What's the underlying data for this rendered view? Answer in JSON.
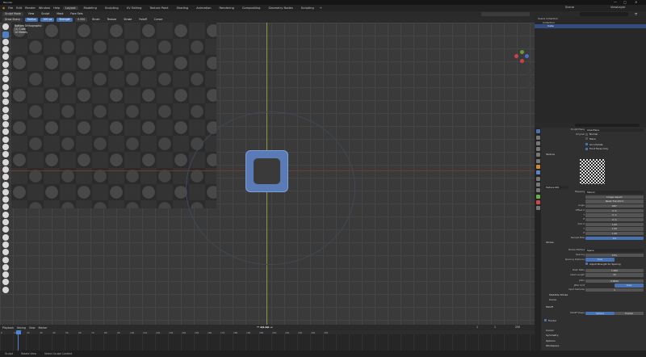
{
  "window": {
    "title": "Blender"
  },
  "menubar": {
    "items": [
      "File",
      "Edit",
      "Render",
      "Window",
      "Help"
    ],
    "workspaces": [
      "Layout",
      "Modeling",
      "Sculpting",
      "UV Editing",
      "Texture Paint",
      "Shading",
      "Animation",
      "Rendering",
      "Compositing",
      "Geometry Nodes",
      "Scripting"
    ],
    "active_workspace": "Layout",
    "scene": "Scene",
    "view_layer": "ViewLayer"
  },
  "viewport": {
    "header1": {
      "mode": "Sculpt Mode",
      "menus": [
        "View",
        "Sculpt",
        "Mask",
        "Face Sets"
      ]
    },
    "header2": {
      "tool": "Draw Sharp",
      "radius_label": "Radius",
      "radius_value": "100 px",
      "strength_label": "Strength",
      "strength_value": "0.500",
      "menus": [
        "Brush",
        "Texture",
        "Stroke",
        "Falloff",
        "Cursor"
      ]
    },
    "info": [
      "Bottom Orthographic",
      "(1) Cube",
      "10 Meters"
    ]
  },
  "timeline": {
    "menus": [
      "Playback",
      "Keying",
      "View",
      "Marker"
    ],
    "frames": [
      "0",
      "10",
      "20",
      "30",
      "40",
      "50",
      "60",
      "70",
      "80",
      "90",
      "100",
      "110",
      "120",
      "130",
      "140",
      "150",
      "160",
      "170",
      "180",
      "190",
      "200",
      "210",
      "220",
      "230",
      "240",
      "250"
    ],
    "current_frame": "1",
    "start": "1",
    "end": "250"
  },
  "statusbar": {
    "items": [
      "Sculpt",
      "Rotate View",
      "Select Sculpt Context"
    ]
  },
  "outliner": {
    "rows": [
      {
        "label": "Scene Collection",
        "selected": false
      },
      {
        "label": "Collection",
        "selected": false
      },
      {
        "label": "Cube",
        "selected": true
      }
    ]
  },
  "properties": {
    "rows": [
      {
        "label": "Sculpt Plane",
        "value": "Area Plane"
      },
      {
        "label": "Original",
        "value": "Normal"
      },
      {
        "label": "",
        "value": "Plane"
      },
      {
        "section": "Texture"
      },
      {
        "label": "",
        "value": "Texture.001"
      },
      {
        "label": "Mapping",
        "value": "Stencil"
      },
      {
        "label": "",
        "value": "Image Aspect"
      },
      {
        "label": "",
        "value": "Reset Transform"
      },
      {
        "label": "Angle",
        "value": "180°"
      },
      {
        "label": "Offset X",
        "value": "0 m"
      },
      {
        "label": "Y",
        "value": "0 m"
      },
      {
        "label": "Z",
        "value": "0 m"
      },
      {
        "label": "Size X",
        "value": "1.00"
      },
      {
        "label": "Y",
        "value": "1.00"
      },
      {
        "label": "Z",
        "value": "1.00"
      },
      {
        "label": "Sample Bias",
        "value": "0.0"
      },
      {
        "section": "Stroke"
      },
      {
        "label": "Stroke Method",
        "value": "Space"
      },
      {
        "label": "Spacing",
        "value": "10%"
      },
      {
        "label": "Spacing Distance",
        "value": "View"
      },
      {
        "label": "",
        "value": "Adjust Strength for Spacing"
      },
      {
        "label": "Dash Ratio",
        "value": "1.000"
      },
      {
        "label": "Dash Length",
        "value": "20"
      },
      {
        "label": "Jitter",
        "value": "0.0000"
      },
      {
        "label": "Jitter Unit",
        "value": "View"
      },
      {
        "label": "Input Samples",
        "value": "1"
      },
      {
        "section": "Stabilize Stroke"
      },
      {
        "section": "Curve"
      },
      {
        "section": "Falloff"
      },
      {
        "label": "Falloff Shape",
        "value": "Sphere"
      },
      {
        "label": "",
        "value": "Frontal"
      },
      {
        "section": "Cursor"
      },
      {
        "section": "Symmetry"
      },
      {
        "section": "Options"
      },
      {
        "section": "Workspace"
      }
    ],
    "checkboxes": {
      "accumulate": "Accumulate",
      "front_faces": "Front Faces Only",
      "normal": "Normal",
      "plane": "Plane"
    }
  },
  "colors": {
    "accent": "#4772b3",
    "plane": "#5a7bb5",
    "selection": "#334d80"
  }
}
